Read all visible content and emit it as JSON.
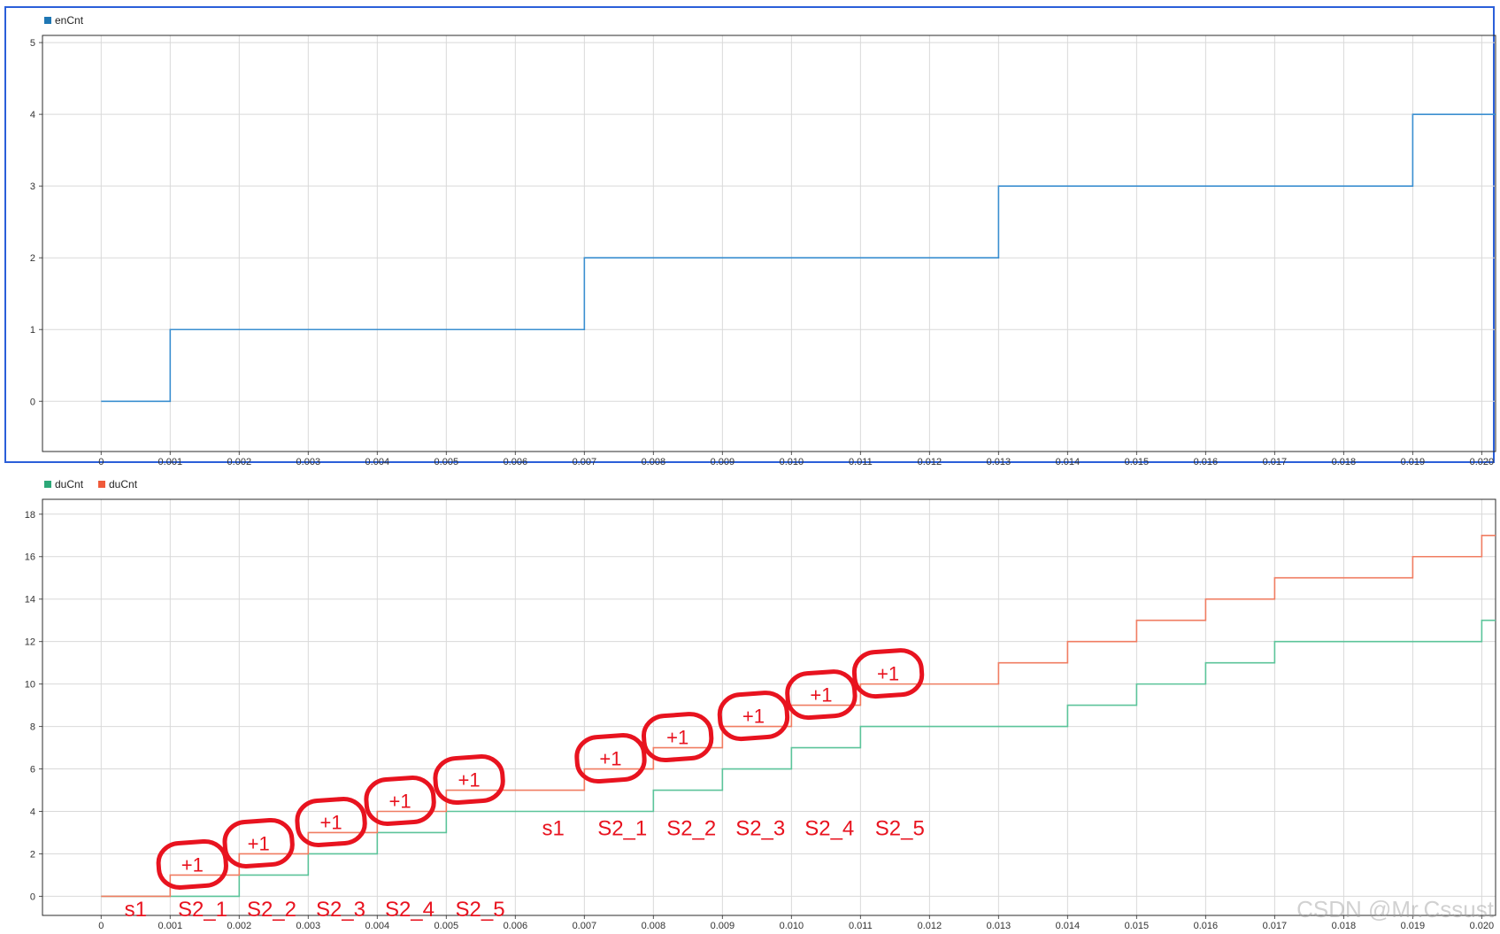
{
  "watermark": "CSDN @Mr.Cssust",
  "colors": {
    "frame_selected": "#2b5fd9",
    "grid": "#d9d9d9",
    "axes_border": "#2b2b2b",
    "annotation": "#e8131f"
  },
  "chart_data": [
    {
      "type": "line",
      "step": "post",
      "legend": [
        {
          "label": "enCnt",
          "color": "#1f77b4"
        }
      ],
      "x_ticks": [
        "0",
        "0.001",
        "0.002",
        "0.003",
        "0.004",
        "0.005",
        "0.006",
        "0.007",
        "0.008",
        "0.009",
        "0.010",
        "0.011",
        "0.012",
        "0.013",
        "0.014",
        "0.015",
        "0.016",
        "0.017",
        "0.018",
        "0.019",
        "0.020"
      ],
      "y_ticks": [
        "0",
        "1",
        "2",
        "3",
        "4",
        "5"
      ],
      "xlim": [
        -0.00085,
        0.0202
      ],
      "ylim": [
        -0.7,
        5.1
      ],
      "grid": true,
      "series": [
        {
          "name": "enCnt",
          "color": "#3b8fd0",
          "x": [
            0,
            0.001,
            0.007,
            0.013,
            0.019,
            0.0202
          ],
          "y": [
            0,
            1,
            2,
            3,
            4,
            4
          ]
        }
      ]
    },
    {
      "type": "line",
      "step": "post",
      "legend": [
        {
          "label": "duCnt",
          "color": "#2ca878"
        },
        {
          "label": "duCnt",
          "color": "#f05a3a"
        }
      ],
      "x_ticks": [
        "0",
        "0.001",
        "0.002",
        "0.003",
        "0.004",
        "0.005",
        "0.006",
        "0.007",
        "0.008",
        "0.009",
        "0.010",
        "0.011",
        "0.012",
        "0.013",
        "0.014",
        "0.015",
        "0.016",
        "0.017",
        "0.018",
        "0.019",
        "0.020"
      ],
      "y_ticks": [
        "0",
        "2",
        "4",
        "6",
        "8",
        "10",
        "12",
        "14",
        "16",
        "18"
      ],
      "xlim": [
        -0.00085,
        0.0202
      ],
      "ylim": [
        -0.9,
        18.7
      ],
      "grid": true,
      "series": [
        {
          "name": "duCnt",
          "color": "#5cc49a",
          "x": [
            0,
            0.002,
            0.003,
            0.004,
            0.005,
            0.008,
            0.009,
            0.01,
            0.011,
            0.014,
            0.015,
            0.016,
            0.017,
            0.02,
            0.0202
          ],
          "y": [
            0,
            1,
            2,
            3,
            4,
            5,
            6,
            7,
            8,
            9,
            10,
            11,
            12,
            13,
            13
          ]
        },
        {
          "name": "duCnt",
          "color": "#f07d62",
          "x": [
            0,
            0.001,
            0.002,
            0.003,
            0.004,
            0.005,
            0.007,
            0.008,
            0.009,
            0.01,
            0.011,
            0.013,
            0.014,
            0.015,
            0.016,
            0.017,
            0.019,
            0.02,
            0.0202
          ],
          "y": [
            0,
            1,
            2,
            3,
            4,
            5,
            6,
            7,
            8,
            9,
            10,
            11,
            12,
            13,
            14,
            15,
            16,
            17,
            17
          ]
        }
      ],
      "annotations": {
        "labels_row1": [
          {
            "text": "s1",
            "x": 0.0005,
            "y": -0.6
          },
          {
            "text": "S2_1",
            "x": 0.00147,
            "y": -0.6
          },
          {
            "text": "S2_2",
            "x": 0.00247,
            "y": -0.6
          },
          {
            "text": "S2_3",
            "x": 0.00347,
            "y": -0.6
          },
          {
            "text": "S2_4",
            "x": 0.00447,
            "y": -0.6
          },
          {
            "text": "S2_5",
            "x": 0.00549,
            "y": -0.6
          }
        ],
        "labels_row2": [
          {
            "text": "s1",
            "x": 0.00655,
            "y": 3.2
          },
          {
            "text": "S2_1",
            "x": 0.00755,
            "y": 3.2
          },
          {
            "text": "S2_2",
            "x": 0.00855,
            "y": 3.2
          },
          {
            "text": "S2_3",
            "x": 0.00955,
            "y": 3.2
          },
          {
            "text": "S2_4",
            "x": 0.01055,
            "y": 3.2
          },
          {
            "text": "S2_5",
            "x": 0.01157,
            "y": 3.2
          }
        ],
        "plus_marks": [
          {
            "text": "+1",
            "x": 0.00132,
            "y": 1.5
          },
          {
            "text": "+1",
            "x": 0.00228,
            "y": 2.5
          },
          {
            "text": "+1",
            "x": 0.00333,
            "y": 3.5
          },
          {
            "text": "+1",
            "x": 0.00433,
            "y": 4.5
          },
          {
            "text": "+1",
            "x": 0.00533,
            "y": 5.5
          },
          {
            "text": "+1",
            "x": 0.00738,
            "y": 6.5
          },
          {
            "text": "+1",
            "x": 0.00835,
            "y": 7.5
          },
          {
            "text": "+1",
            "x": 0.00945,
            "y": 8.5
          },
          {
            "text": "+1",
            "x": 0.01043,
            "y": 9.5
          },
          {
            "text": "+1",
            "x": 0.0114,
            "y": 10.5
          }
        ]
      }
    }
  ]
}
